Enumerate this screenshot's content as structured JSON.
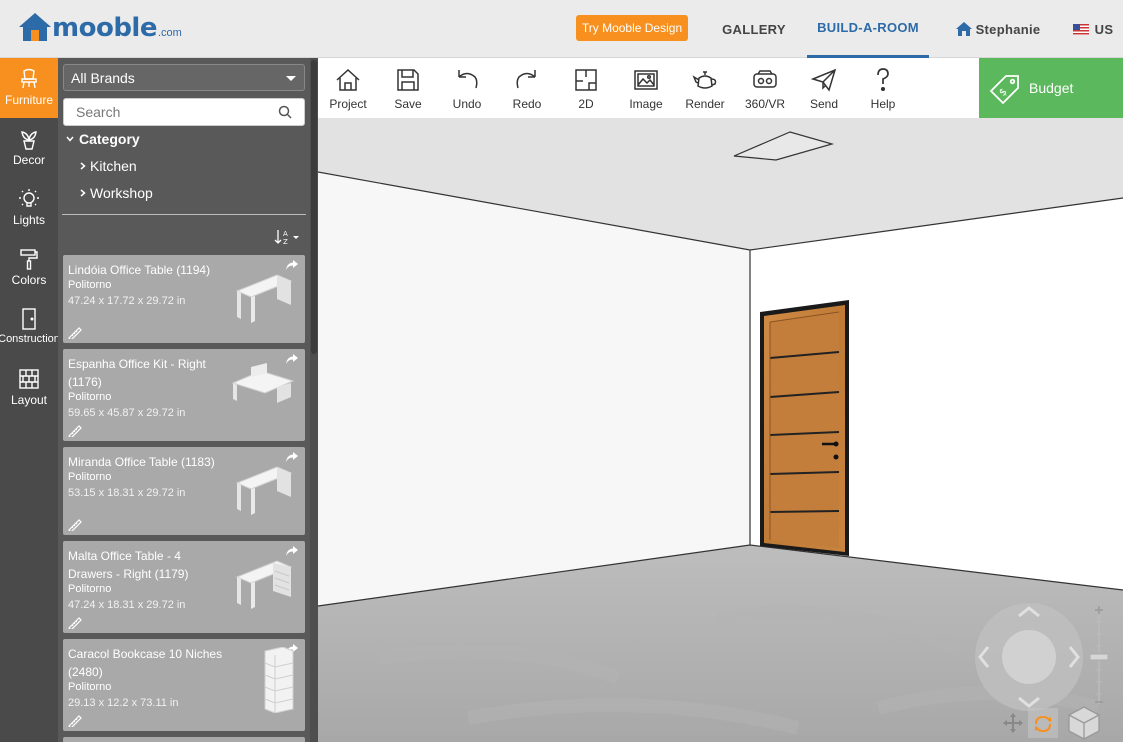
{
  "header": {
    "logo_text": "mooble",
    "logo_domain": ".com",
    "try_button": "Try Mooble Design",
    "nav": {
      "gallery": "GALLERY",
      "build_a_room": "BUILD-A-ROOM",
      "user": "Stephanie",
      "country": "US"
    }
  },
  "rail": {
    "items": [
      {
        "label": "Furniture",
        "icon": "chair-icon",
        "active": true
      },
      {
        "label": "Decor",
        "icon": "plant-icon"
      },
      {
        "label": "Lights",
        "icon": "lightbulb-icon"
      },
      {
        "label": "Colors",
        "icon": "paint-roller-icon"
      },
      {
        "label": "Construction",
        "icon": "door-icon"
      },
      {
        "label": "Layout",
        "icon": "brick-wall-icon"
      }
    ]
  },
  "panel": {
    "brand_select": "All Brands",
    "search_placeholder": "Search",
    "category": {
      "label": "Category",
      "items": [
        "Kitchen",
        "Workshop"
      ]
    },
    "products": [
      {
        "name": "Lindóia Office Table (1194)",
        "brand": "Politorno",
        "dims": "47.24 x 17.72 x 29.72 in"
      },
      {
        "name": "Espanha Office Kit - Right (1176)",
        "brand": "Politorno",
        "dims": "59.65 x 45.87 x 29.72 in"
      },
      {
        "name": "Miranda Office Table (1183)",
        "brand": "Politorno",
        "dims": "53.15 x 18.31 x 29.72 in"
      },
      {
        "name": "Malta Office Table - 4 Drawers - Right (1179)",
        "brand": "Politorno",
        "dims": "47.24 x 18.31 x 29.72 in"
      },
      {
        "name": "Caracol Bookcase 10 Niches (2480)",
        "brand": "Politorno",
        "dims": "29.13 x 12.2 x 73.11 in"
      }
    ]
  },
  "toolbar": {
    "tools": [
      {
        "label": "Project",
        "icon": "house-icon"
      },
      {
        "label": "Save",
        "icon": "floppy-disk-icon"
      },
      {
        "label": "Undo",
        "icon": "undo-icon"
      },
      {
        "label": "Redo",
        "icon": "redo-icon"
      },
      {
        "label": "2D",
        "icon": "floorplan-icon"
      },
      {
        "label": "Image",
        "icon": "image-icon"
      },
      {
        "label": "Render",
        "icon": "teapot-icon"
      },
      {
        "label": "360/VR",
        "icon": "vr-headset-icon"
      },
      {
        "label": "Send",
        "icon": "paper-plane-icon"
      },
      {
        "label": "Help",
        "icon": "question-mark-icon"
      }
    ],
    "budget": "Budget"
  },
  "colors": {
    "brand_blue": "#2d6aa8",
    "accent_orange": "#f7901e",
    "budget_green": "#5cb85c",
    "door_wood": "#c47e3c"
  }
}
